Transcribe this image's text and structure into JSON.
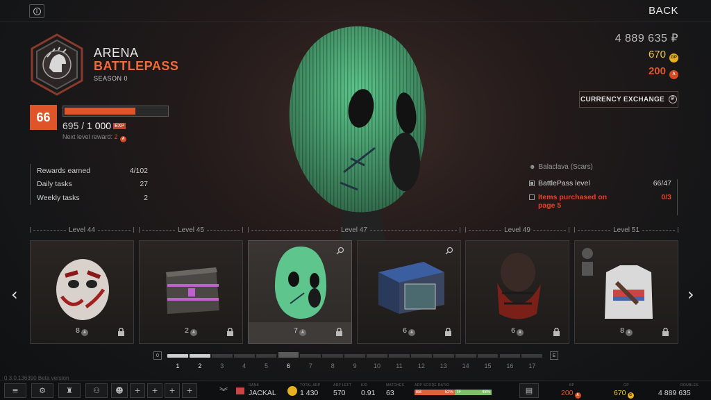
{
  "top": {
    "back_label": "BACK",
    "info_icon": "info-icon"
  },
  "header": {
    "title_line1": "ARENA",
    "title_line2": "BATTLEPASS",
    "season": "SEASON 0"
  },
  "level": {
    "current": "66",
    "progress_fraction": 0.695,
    "exp_current": "695",
    "exp_separator": "/",
    "exp_total": "1 000",
    "exp_tag": "EXP",
    "next_reward_label": "Next level reward:",
    "next_reward_value": "2"
  },
  "stats": [
    {
      "label": "Rewards earned",
      "value": "4/102"
    },
    {
      "label": "Daily tasks",
      "value": "27"
    },
    {
      "label": "Weekly tasks",
      "value": "2"
    }
  ],
  "currencies": {
    "roubles": "4 889 635 ₽",
    "gp": "670",
    "gp_badge": "GP",
    "arena": "200",
    "exchange_label": "CURRENCY EXCHANGE"
  },
  "item_info": {
    "name": "Balaclava (Scars)",
    "req_level_label": "BattlePass level",
    "req_level_value": "66/47",
    "req_items_label": "Items purchased on page 5",
    "req_items_value": "0/3"
  },
  "level_labels": [
    "Level 44",
    "Level 45",
    "Level 47",
    "Level 49",
    "Level 51"
  ],
  "cards": [
    {
      "cost": "8",
      "name": "card-hockey-mask"
    },
    {
      "cost": "2",
      "name": "card-case"
    },
    {
      "cost": "7",
      "name": "card-balaclava"
    },
    {
      "cost": "6",
      "name": "card-box"
    },
    {
      "cost": "6",
      "name": "card-shemagh"
    },
    {
      "cost": "8",
      "name": "card-tshirt"
    }
  ],
  "track": {
    "start": "0",
    "end": "E",
    "pages": [
      "1",
      "2",
      "3",
      "4",
      "5",
      "6",
      "7",
      "8",
      "9",
      "10",
      "11",
      "12",
      "13",
      "14",
      "15",
      "16",
      "17"
    ],
    "completed": 2,
    "current": 6
  },
  "version": "0.3.0.136390 Beta version",
  "bottom": {
    "rank_label": "RANK",
    "name": "JACKAL",
    "total_arp_label": "TOTAL ARP",
    "total_arp": "1 430",
    "arp_left_label": "ARP LEFT",
    "arp_left": "570",
    "kd_label": "K/D",
    "kd": "0.91",
    "matches_label": "MATCHES",
    "matches": "63",
    "ratio_label": "ARP SCORE RATIO",
    "ratio_left_a": "BB",
    "ratio_left_b": "52%",
    "ratio_right_a": "TF",
    "ratio_right_b": "48%",
    "bp_label": "BP",
    "bp": "200",
    "gp_label": "GP",
    "gp": "670",
    "roubles_label": "ROUBLES",
    "roubles": "4 889 635"
  }
}
